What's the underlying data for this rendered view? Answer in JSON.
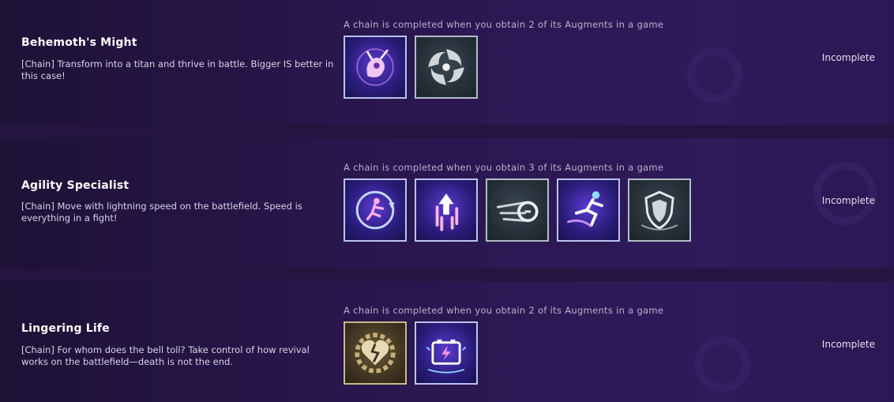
{
  "chains": [
    {
      "title": "Behemoth's Might",
      "description": "[Chain] Transform into a titan and thrive in battle. Bigger IS better in this case!",
      "note": "A chain is completed when you obtain 2 of its Augments in a game",
      "status": "Incomplete",
      "augments": [
        {
          "icon": "titan-spirit-icon",
          "style": "purple"
        },
        {
          "icon": "vortex-swirl-icon",
          "style": "dark"
        }
      ]
    },
    {
      "title": "Agility Specialist",
      "description": "[Chain] Move with lightning speed on the battlefield. Speed is everything in a fight!",
      "note": "A chain is completed when you obtain 3 of its Augments in a game",
      "status": "Incomplete",
      "augments": [
        {
          "icon": "runner-clock-icon",
          "style": "purple"
        },
        {
          "icon": "upward-dash-icon",
          "style": "purple"
        },
        {
          "icon": "speed-dash-icon",
          "style": "dark"
        },
        {
          "icon": "sprinter-icon",
          "style": "purple"
        },
        {
          "icon": "shield-burst-icon",
          "style": "dark"
        }
      ]
    },
    {
      "title": "Lingering Life",
      "description": "[Chain] For whom does the bell toll? Take control of how revival works on the battlefield—death is not the end.",
      "note": "A chain is completed when you obtain 2 of its Augments in a game",
      "status": "Incomplete",
      "augments": [
        {
          "icon": "broken-heart-gear-icon",
          "style": "gold"
        },
        {
          "icon": "battery-charge-icon",
          "style": "purple"
        }
      ]
    }
  ]
}
